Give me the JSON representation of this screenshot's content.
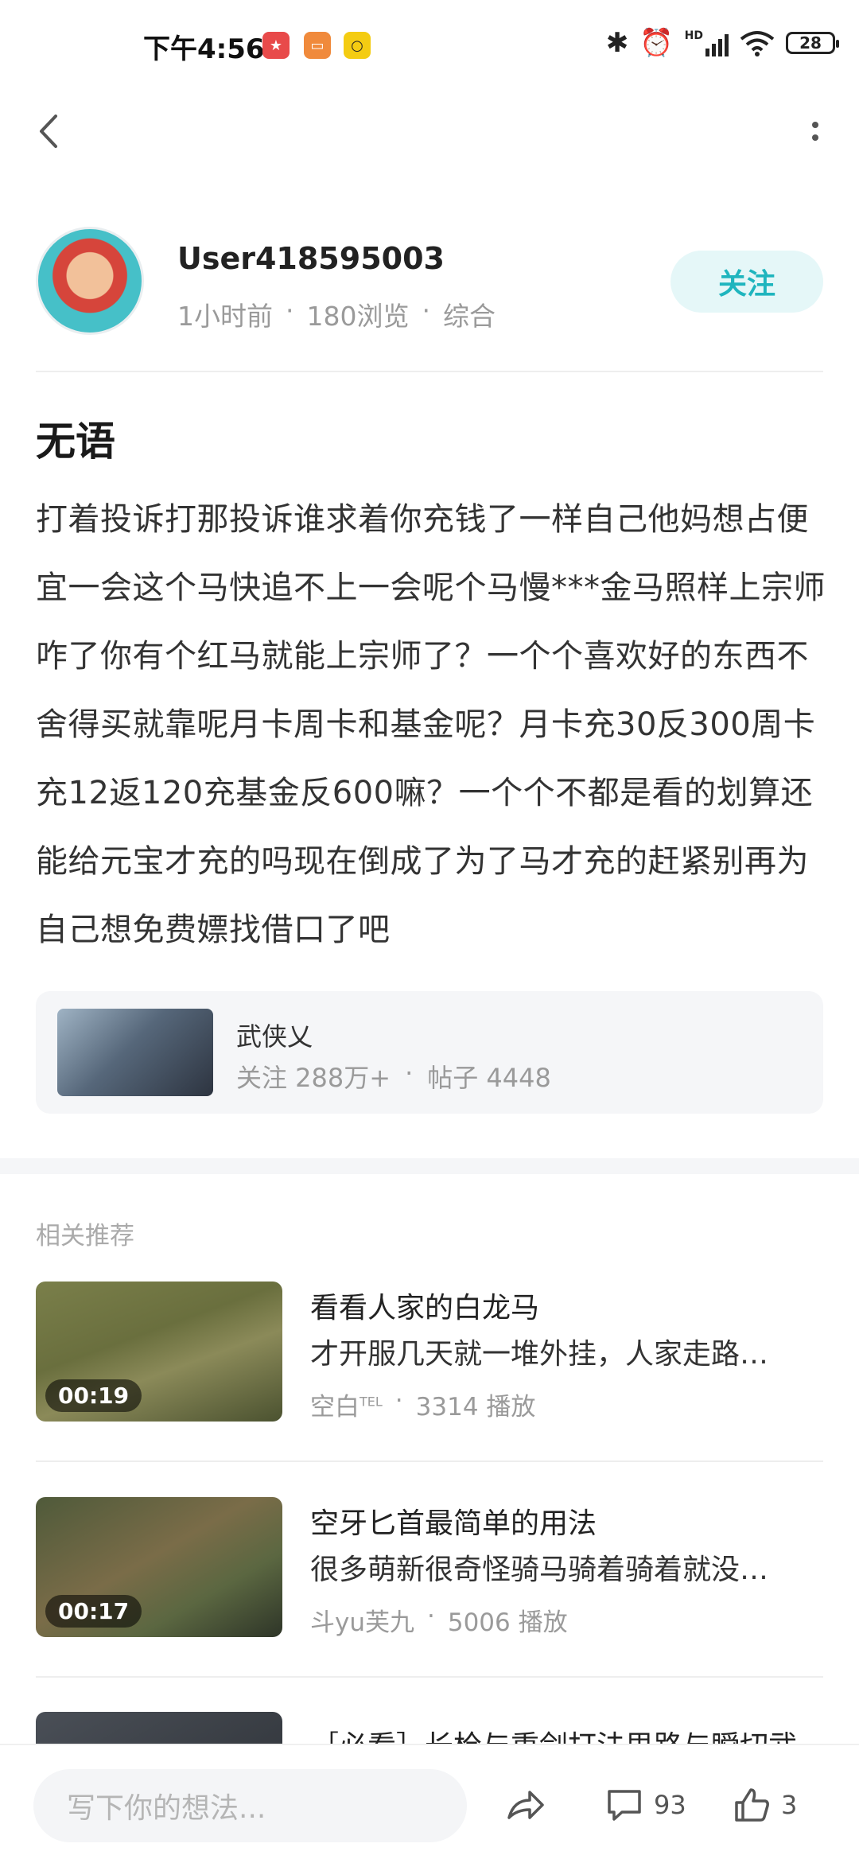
{
  "status_bar": {
    "time": "下午4:56",
    "battery": "28",
    "signal_label": "HD"
  },
  "author": {
    "username": "User418595003",
    "time_ago": "1小时前",
    "views": "180浏览",
    "category": "综合",
    "follow_label": "关注"
  },
  "post": {
    "title": "无语",
    "body": "打着投诉打那投诉谁求着你充钱了一样自己他妈想占便宜一会这个马快追不上一会呢个马慢***金马照样上宗师咋了你有个红马就能上宗师了？一个个喜欢好的东西不舍得买就靠呢月卡周卡和基金呢？月卡充30反300周卡充12返120充基金反600嘛？一个个不都是看的划算还能给元宝才充的吗现在倒成了为了马才充的赶紧别再为自己想免费嫖找借口了吧"
  },
  "game": {
    "name": "武侠乂",
    "followers": "关注 288万+",
    "posts": "帖子 4448",
    "separator": "·"
  },
  "recommend": {
    "heading": "相关推荐",
    "items": [
      {
        "title": "看看人家的白龙马",
        "subtitle": "才开服几天就一堆外挂，人家走路…",
        "duration": "00:19",
        "author": "空白",
        "author_badge": "TEL",
        "plays": "3314 播放"
      },
      {
        "title": "空牙匕首最简单的用法",
        "subtitle": "很多萌新很奇怪骑马骑着骑着就没…",
        "duration": "00:17",
        "author": "斗yu芙九",
        "author_badge": "",
        "plays": "5006 播放"
      },
      {
        "title": "［必看］长枪与重剑打法思路与瞬切武",
        "subtitle": "",
        "duration": "",
        "author": "",
        "author_badge": "",
        "plays": ""
      }
    ]
  },
  "bottom_bar": {
    "comment_placeholder": "写下你的想法...",
    "comment_count": "93",
    "like_count": "3"
  },
  "colors": {
    "accent": "#1fb5be",
    "follow_bg": "#e5f7f8",
    "card_bg": "#f5f6f8"
  }
}
